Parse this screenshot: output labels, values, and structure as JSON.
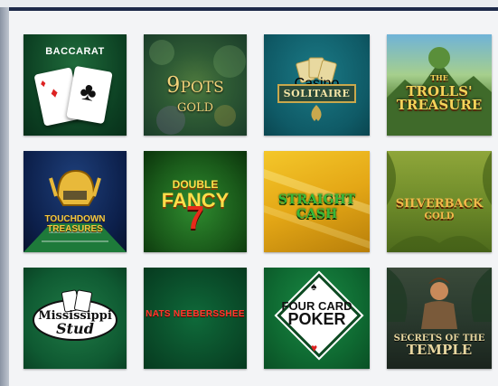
{
  "games": [
    {
      "id": "baccarat",
      "title": "BACCARAT"
    },
    {
      "id": "nine-pots-of-gold",
      "title": "9 POTS OF GOLD"
    },
    {
      "id": "casino-solitaire",
      "title": "SOLITAIRE",
      "subtitle": "Casino"
    },
    {
      "id": "trolls-treasure",
      "title": "THE TROLLS' TREASURE"
    },
    {
      "id": "touchdown-treasures",
      "title": "TOUCHDOWN TREASURES"
    },
    {
      "id": "double-fancy-7s",
      "title": "DOUBLE FANCY 7s"
    },
    {
      "id": "straight-cash",
      "title": "STRAIGHT CASH"
    },
    {
      "id": "silverback-gold",
      "title": "SILVERBACK GOLD"
    },
    {
      "id": "mississippi-stud",
      "title": "Mississippi Stud"
    },
    {
      "id": "nats-neebersshee",
      "title": "NATS NEEBERSSHEE"
    },
    {
      "id": "four-card-poker",
      "title": "FOUR CARD POKER"
    },
    {
      "id": "secrets-of-the-temple",
      "title": "SECRETS OF THE TEMPLE"
    }
  ],
  "text": {
    "baccarat": "BACCARAT",
    "pots_line1": "9",
    "pots_line2": "POTS",
    "pots_line3": "GOLD",
    "solitaire_sub": "Casino",
    "solitaire": "SOLITAIRE",
    "trolls_the": "THE",
    "trolls_1": "TROLLS'",
    "trolls_2": "TREASURE",
    "touchdown_1": "TOUCHDOWN",
    "touchdown_2": "TREASURES",
    "fancy_1": "DOUBLE",
    "fancy_2": "FANCY",
    "fancy_3": "7",
    "cash": "STRAIGHT CASH",
    "silver_1": "SILVERBACK",
    "silver_2": "GOLD",
    "miss_1": "Mississippi",
    "miss_2": "Stud",
    "nats_1": "NATS NEEBERSSHEE",
    "poker_1": "FOUR CARD",
    "poker_2": "POKER",
    "temple_1": "SECRETS OF THE",
    "temple_2": "TEMPLE"
  },
  "colors": {
    "topline": "#1d2a4a",
    "panel": "#f3f4f6"
  }
}
